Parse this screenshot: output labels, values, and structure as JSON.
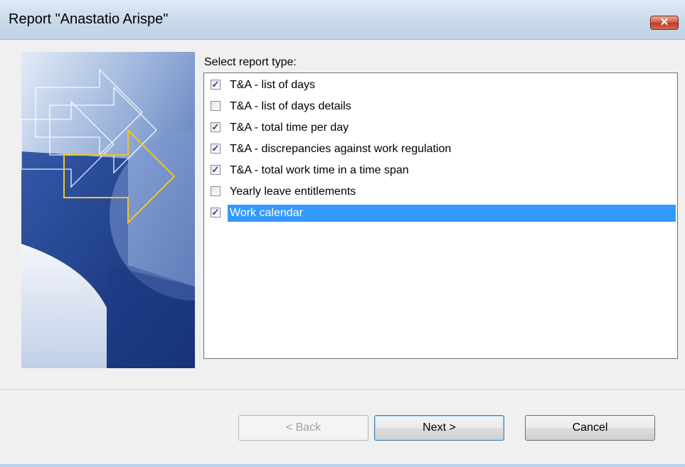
{
  "window": {
    "title": "Report \"Anastatio Arispe\"",
    "close_glyph": "✕"
  },
  "main": {
    "prompt": "Select report type:",
    "report_types": [
      {
        "label": "T&A - list of days",
        "checked": true,
        "selected": false
      },
      {
        "label": "T&A - list of days  details",
        "checked": false,
        "selected": false
      },
      {
        "label": "T&A - total time per day",
        "checked": true,
        "selected": false
      },
      {
        "label": "T&A - discrepancies against work regulation",
        "checked": true,
        "selected": false
      },
      {
        "label": "T&A - total  work time in a time span",
        "checked": true,
        "selected": false
      },
      {
        "label": "Yearly leave entitlements",
        "checked": false,
        "selected": false
      },
      {
        "label": "Work calendar",
        "checked": true,
        "selected": true
      }
    ]
  },
  "buttons": {
    "back_label": "< Back",
    "back_enabled": false,
    "next_label": "Next >",
    "cancel_label": "Cancel"
  },
  "colors": {
    "selection": "#3399ff",
    "checkmark": "#21469d",
    "title_bar": "#c9d9ea",
    "art_dark_blue": "#1f3f86",
    "art_accent_yellow": "#f2c422"
  }
}
